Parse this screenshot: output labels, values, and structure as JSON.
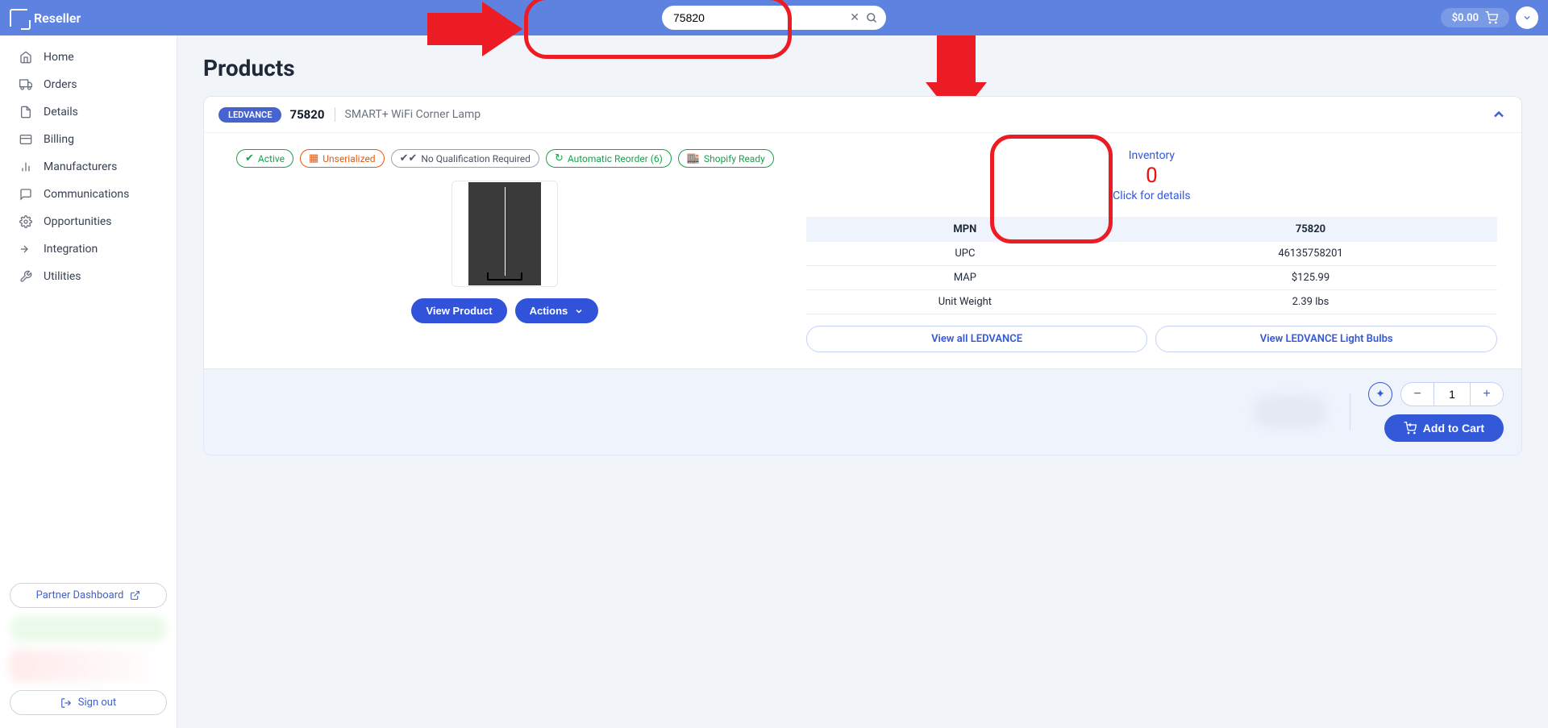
{
  "brand": "Reseller",
  "search": {
    "value": "75820"
  },
  "cart": {
    "total": "$0.00"
  },
  "nav": {
    "home": "Home",
    "orders": "Orders",
    "details": "Details",
    "billing": "Billing",
    "manufacturers": "Manufacturers",
    "communications": "Communications",
    "opportunities": "Opportunities",
    "integration": "Integration",
    "utilities": "Utilities"
  },
  "sidebarFooter": {
    "partner": "Partner Dashboard",
    "signout": "Sign out"
  },
  "page": {
    "title": "Products"
  },
  "product": {
    "brand": "LEDVANCE",
    "sku": "75820",
    "name": "SMART+ WiFi Corner Lamp",
    "tags": {
      "active": "Active",
      "unserialized": "Unserialized",
      "noqual": "No Qualification Required",
      "reorder": "Automatic Reorder (6)",
      "shopify": "Shopify Ready"
    },
    "buttons": {
      "view": "View Product",
      "actions": "Actions"
    },
    "inventory": {
      "label": "Inventory",
      "value": "0",
      "link": "Click for details"
    },
    "specs": {
      "mpn_label": "MPN",
      "mpn_val": "75820",
      "upc_label": "UPC",
      "upc_val": "46135758201",
      "map_label": "MAP",
      "map_val": "$125.99",
      "weight_label": "Unit Weight",
      "weight_val": "2.39 lbs"
    },
    "links": {
      "all": "View all LEDVANCE",
      "category": "View LEDVANCE Light Bulbs"
    },
    "footer": {
      "qty": "1",
      "addcart": "Add to Cart"
    }
  }
}
